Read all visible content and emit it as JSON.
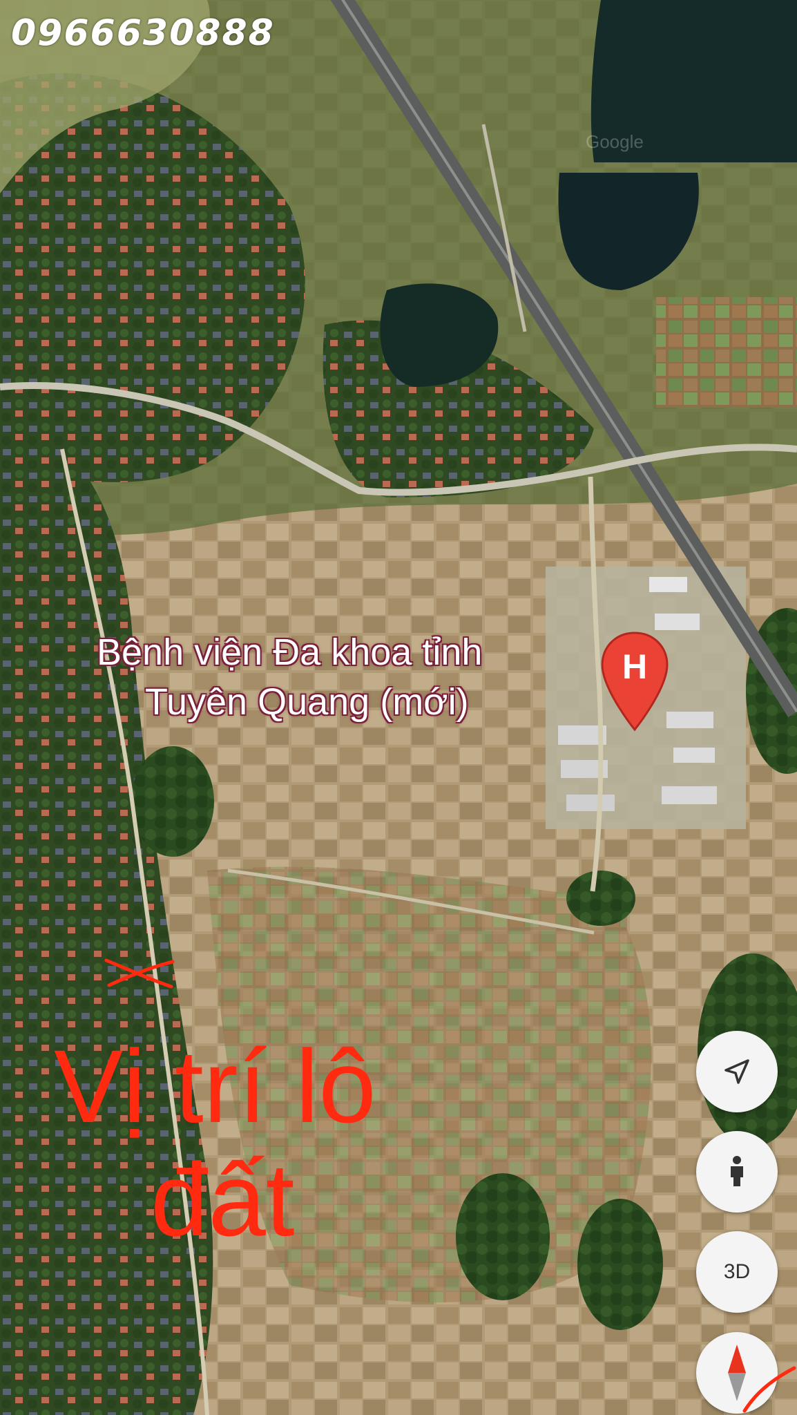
{
  "watermark": {
    "phone": "0966630888",
    "provider": "Google"
  },
  "map": {
    "type": "satellite",
    "place_label": {
      "line1": "Bệnh viện Đa khoa tỉnh",
      "line2": "Tuyên Quang (mới)",
      "pin_icon": "hospital-pin-icon",
      "pin_letter": "H",
      "pin_color": "#ea4335"
    },
    "annotation": {
      "line1": "Vị trí lô",
      "line2": "đất",
      "color": "#ff2a10",
      "marker_icon": "cross-mark-icon"
    }
  },
  "controls": {
    "location": {
      "icon": "navigation-arrow-icon"
    },
    "street_view": {
      "icon": "pegman-icon"
    },
    "tilt": {
      "label": "3D"
    },
    "compass": {
      "icon": "compass-icon"
    }
  }
}
